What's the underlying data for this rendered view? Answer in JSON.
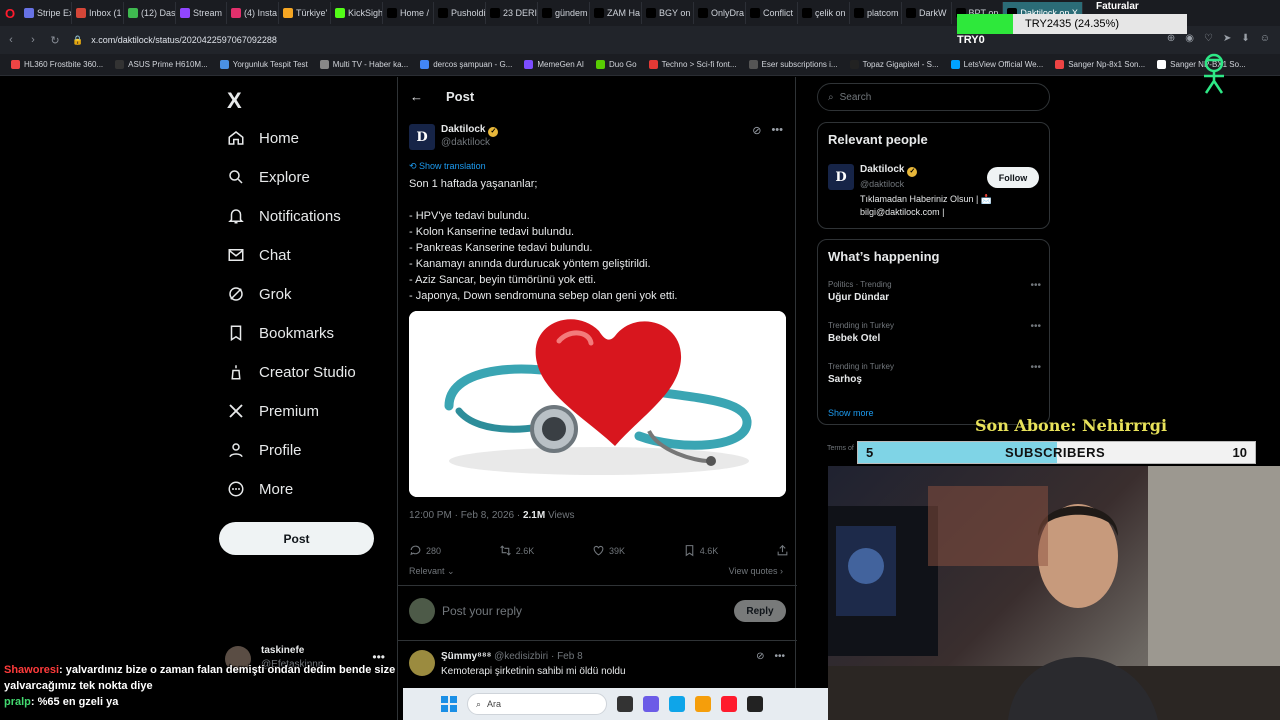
{
  "browser": {
    "tabs": [
      {
        "label": "Stripe Ex",
        "color": "#6772e5"
      },
      {
        "label": "Inbox (1",
        "color": "#d44638"
      },
      {
        "label": "(12) Das",
        "color": "#3fb950"
      },
      {
        "label": "Stream",
        "color": "#9146ff"
      },
      {
        "label": "(4) Insta",
        "color": "#e1306c"
      },
      {
        "label": "Türkiye'",
        "color": "#f5a623"
      },
      {
        "label": "KickSigh",
        "color": "#53fc18"
      },
      {
        "label": "Home /",
        "color": "#000000"
      },
      {
        "label": "Pusholdi",
        "color": "#000000"
      },
      {
        "label": "23 DERI",
        "color": "#000000"
      },
      {
        "label": "gündem",
        "color": "#000000"
      },
      {
        "label": "ZAM Ha",
        "color": "#000000"
      },
      {
        "label": "BGY on",
        "color": "#000000"
      },
      {
        "label": "OnlyDra",
        "color": "#000000"
      },
      {
        "label": "Conflict",
        "color": "#000000"
      },
      {
        "label": "çelik on",
        "color": "#000000"
      },
      {
        "label": "platcom",
        "color": "#000000"
      },
      {
        "label": "DarkW",
        "color": "#000000"
      },
      {
        "label": "BPT on",
        "color": "#000000"
      },
      {
        "label": "Daktilock on X",
        "color": "#000000"
      }
    ],
    "url": "x.com/daktilock/status/2020422597067092288",
    "bookmarks": [
      {
        "label": "HL360 Frostbite 360...",
        "color": "#e44"
      },
      {
        "label": "ASUS Prime H610M...",
        "color": "#333"
      },
      {
        "label": "Yorgunluk Tespit Test",
        "color": "#4a90e2"
      },
      {
        "label": "Multi TV - Haber ka...",
        "color": "#888"
      },
      {
        "label": "dercos şampuan - G...",
        "color": "#4285f4"
      },
      {
        "label": "MemeGen AI",
        "color": "#7c4dff"
      },
      {
        "label": "Duo Go",
        "color": "#58cc02"
      },
      {
        "label": "Techno > Sci-fi font...",
        "color": "#e53935"
      },
      {
        "label": "Eser subscriptions i...",
        "color": "#555"
      },
      {
        "label": "Topaz Gigapixel - S...",
        "color": "#222"
      },
      {
        "label": "LetsView Official We...",
        "color": "#00a2ff"
      },
      {
        "label": "Sanger Np-8x1 Son...",
        "color": "#e44"
      },
      {
        "label": "Sanger NP-BX1 So...",
        "color": "#fff"
      }
    ]
  },
  "nav": {
    "logo": "X",
    "items": [
      {
        "label": "Home",
        "icon": "home-icon"
      },
      {
        "label": "Explore",
        "icon": "search-icon"
      },
      {
        "label": "Notifications",
        "icon": "bell-icon"
      },
      {
        "label": "Chat",
        "icon": "mail-icon"
      },
      {
        "label": "Grok",
        "icon": "grok-icon"
      },
      {
        "label": "Bookmarks",
        "icon": "bookmark-icon"
      },
      {
        "label": "Creator Studio",
        "icon": "creator-icon"
      },
      {
        "label": "Premium",
        "icon": "premium-icon"
      },
      {
        "label": "Profile",
        "icon": "person-icon"
      },
      {
        "label": "More",
        "icon": "more-icon"
      }
    ],
    "post_button": "Post",
    "account": {
      "name": "taskinefe",
      "handle": "@Efetaskinnn"
    }
  },
  "post": {
    "header_title": "Post",
    "author": {
      "name": "Daktilock",
      "handle": "@daktilock",
      "avatar_letter": "D"
    },
    "show_translation": "Show translation",
    "text": "Son 1 haftada yaşananlar;\n\n- HPV'ye tedavi bulundu.\n- Kolon Kanserine tedavi bulundu.\n- Pankreas Kanserine tedavi bulundu.\n- Kanamayı anında durdurucak yöntem geliştirildi.\n- Aziz Sancar, beyin tümörünü yok etti.\n- Japonya, Down sendromuna sebep olan geni yok etti.",
    "timestamp": "12:00 PM · Feb 8, 2026 · ",
    "views_count": "2.1M",
    "views_label": " Views",
    "actions": {
      "replies": "280",
      "reposts": "2.6K",
      "likes": "39K",
      "bookmarks": "4.6K"
    },
    "sort_label": "Relevant ⌄",
    "view_quotes": "View quotes ›",
    "reply_placeholder": "Post your reply",
    "reply_button": "Reply"
  },
  "replies": [
    {
      "name": "Şümmy⁸⁸⁸",
      "handle": "@kedisizbiri",
      "time": "Feb 8",
      "text": "Kemoterapi şirketinin sahibi mi öldü noldu"
    }
  ],
  "sidebar": {
    "search_placeholder": "Search",
    "relevant_title": "Relevant people",
    "relevant": {
      "name": "Daktilock",
      "handle": "@daktilock",
      "follow": "Follow",
      "bio": "Tıklamadan Haberiniz Olsun | 📩 bilgi@daktilock.com |",
      "avatar_letter": "D"
    },
    "happening_title": "What’s happening",
    "trends": [
      {
        "category": "Politics · Trending",
        "name": "Uğur Dündar"
      },
      {
        "category": "Trending in Turkey",
        "name": "Bebek Otel"
      },
      {
        "category": "Trending in Turkey",
        "name": "Sarhoş"
      }
    ],
    "show_more": "Show more",
    "terms": "Terms of"
  },
  "overlay": {
    "faturalar": "Faturalar",
    "donation_text": "TRY2435 (24.35%)",
    "donation_fraction": 0.2435,
    "try_label": "TRY0",
    "son_abone": "Son Abone: Nehirrrgi",
    "subs_left": "5",
    "subs_center": "SUBSCRIBERS",
    "subs_right": "10",
    "subs_fraction": 0.5
  },
  "chat": [
    {
      "user": "Shaworesi",
      "text": ": yalvardınız bize o zaman falan demişti ondan dedim bende size"
    },
    {
      "user": "",
      "text": "yalvarcağımız tek nokta diye"
    },
    {
      "user": "pralp",
      "text": ": %65 en gzeli ya"
    }
  ],
  "taskbar": {
    "search": "Ara"
  }
}
